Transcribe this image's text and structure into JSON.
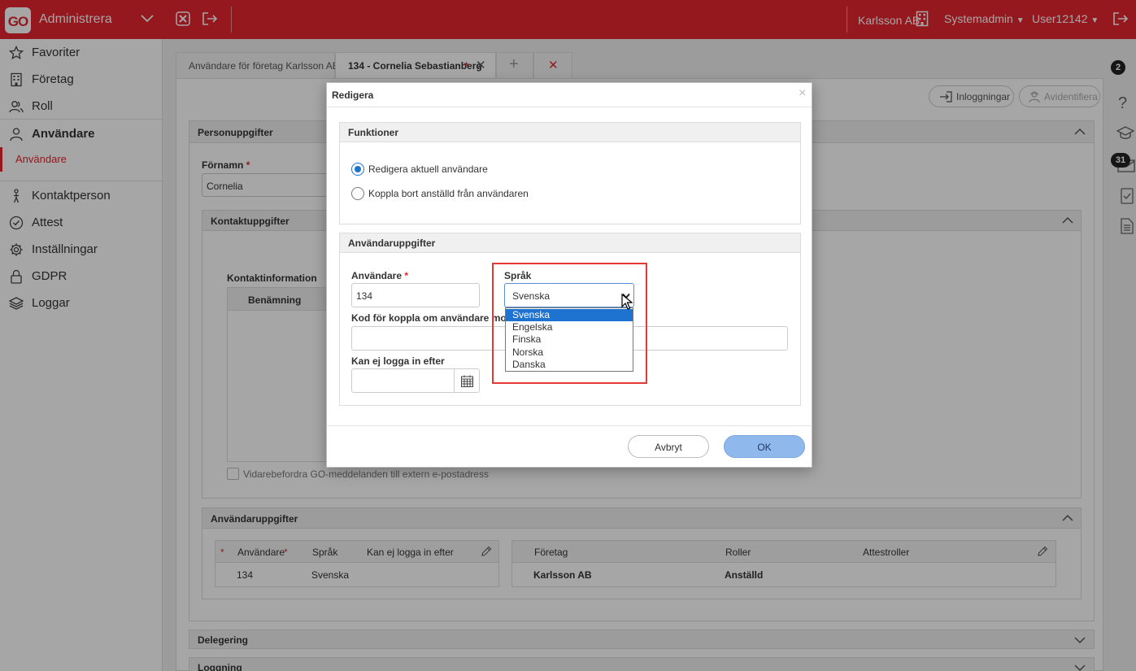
{
  "topbar": {
    "logo": "GO",
    "app_title": "Administrera",
    "company": "Karlsson AB",
    "role": "Systemadmin",
    "user": "User12142"
  },
  "sidebar": {
    "items": [
      {
        "label": "Favoriter",
        "icon": "star-icon"
      },
      {
        "label": "Företag",
        "icon": "building-icon"
      },
      {
        "label": "Roll",
        "icon": "users-icon"
      },
      {
        "label": "Användare",
        "icon": "user-icon"
      },
      {
        "label": "Kontaktperson",
        "icon": "person-icon"
      },
      {
        "label": "Attest",
        "icon": "check-circle-icon"
      },
      {
        "label": "Inställningar",
        "icon": "gear-icon"
      },
      {
        "label": "GDPR",
        "icon": "lock-icon"
      },
      {
        "label": "Loggar",
        "icon": "layers-icon"
      }
    ],
    "sub_item": "Användare"
  },
  "tabs": [
    {
      "label": "Användare för företag Karlsson AB"
    },
    {
      "label": "134 - Cornelia Sebastianberg",
      "modified_marker": "*"
    }
  ],
  "toolbar": {
    "logins": "Inloggningar",
    "deidentify": "Avidentifiera"
  },
  "right_rail": {
    "info_badge": "2",
    "mail_badge": "31"
  },
  "personal": {
    "header": "Personuppgifter",
    "firstname_label": "Förnamn",
    "firstname_value": "Cornelia",
    "required_marker": "*"
  },
  "contact": {
    "header": "Kontaktuppgifter",
    "info_label": "Kontaktinformation",
    "col_name": "Benämning",
    "forward_label": "Vidarebefordra GO-meddelanden till extern e-postadress"
  },
  "user_section": {
    "header": "Användaruppgifter",
    "left_headers": [
      "Användare",
      "Språk",
      "Kan ej logga in efter"
    ],
    "left_row": [
      "134",
      "Svenska",
      ""
    ],
    "right_headers": [
      "Företag",
      "Roller",
      "Attestroller"
    ],
    "right_row": [
      "Karlsson AB",
      "Anställd",
      ""
    ]
  },
  "collapsed_sections": [
    "Delegering",
    "Loggning"
  ],
  "modal": {
    "title": "Redigera",
    "functions_header": "Funktioner",
    "radio_edit": "Redigera aktuell användare",
    "radio_unlink": "Koppla bort anställd från användaren",
    "radio_selected": "edit",
    "user_header": "Användaruppgifter",
    "user_label": "Användare",
    "user_value": "134",
    "required_marker": "*",
    "language_label": "Språk",
    "language_value": "Svenska",
    "language_options": [
      "Svenska",
      "Engelska",
      "Finska",
      "Norska",
      "Danska"
    ],
    "code_label": "Kod för koppla om användare mot ny lo",
    "cannot_login_label": "Kan ej logga in efter",
    "cancel": "Avbryt",
    "ok": "OK"
  },
  "colors": {
    "brand": "#e3262e",
    "ok_button": "#8fb8ec",
    "highlight": "#e53935",
    "selected_option": "#1e73d0"
  }
}
